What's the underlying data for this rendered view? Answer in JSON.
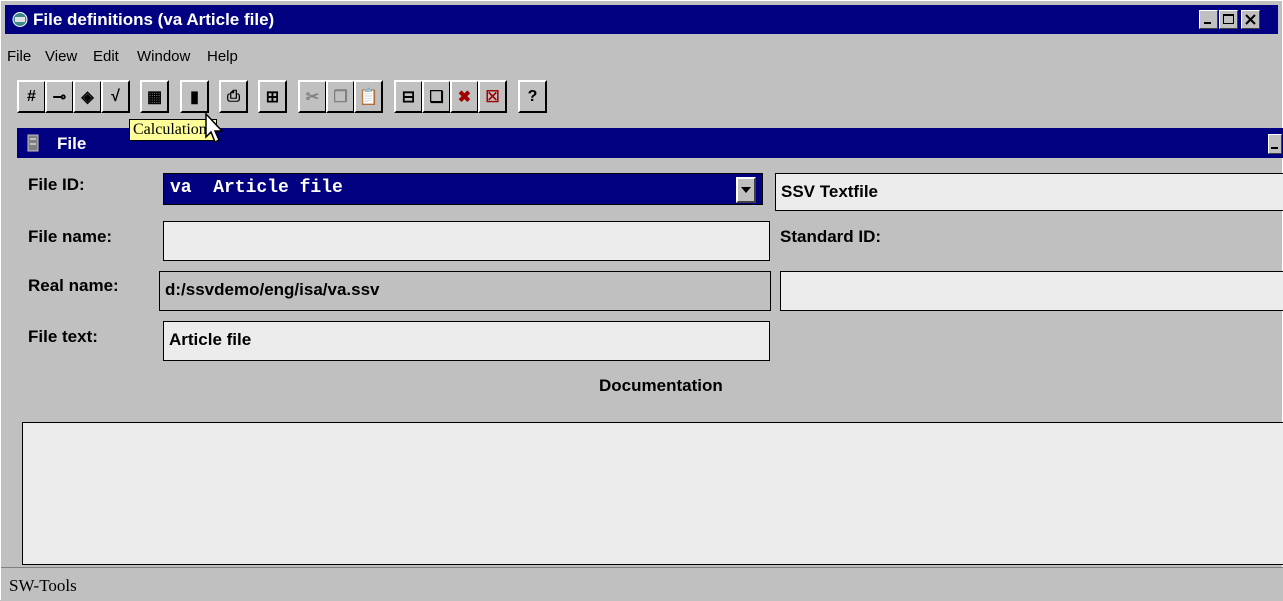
{
  "window": {
    "title": "File definitions (va Article file)"
  },
  "menu": [
    {
      "label": "File"
    },
    {
      "label": "View"
    },
    {
      "label": "Edit"
    },
    {
      "label": "Window"
    },
    {
      "label": "Help"
    }
  ],
  "toolbar": {
    "buttons": [
      {
        "icon": "hash-icon",
        "glyph": "#"
      },
      {
        "icon": "key-icon",
        "glyph": "⊸"
      },
      {
        "icon": "diamond-icon",
        "glyph": "◈"
      },
      {
        "icon": "check-icon",
        "glyph": "√"
      },
      {
        "icon": "calculator-icon",
        "glyph": "▦"
      },
      {
        "icon": "trash-icon",
        "glyph": "▮"
      },
      {
        "icon": "printer-icon",
        "glyph": "⎙"
      },
      {
        "icon": "tree-icon",
        "glyph": "⊞"
      },
      {
        "icon": "cut-icon",
        "glyph": "✂"
      },
      {
        "icon": "copy-icon",
        "glyph": "❐"
      },
      {
        "icon": "paste-icon",
        "glyph": "📋"
      },
      {
        "icon": "tile-icon",
        "glyph": "⊟"
      },
      {
        "icon": "cascade-icon",
        "glyph": "❏"
      },
      {
        "icon": "close-windows-icon",
        "glyph": "✖"
      },
      {
        "icon": "close-all-icon",
        "glyph": "☒"
      },
      {
        "icon": "help-icon",
        "glyph": "?"
      }
    ],
    "tooltip": "Calculations"
  },
  "child_window": {
    "title": "File"
  },
  "form": {
    "file_id_label": "File ID:",
    "file_id_value": "va  Article file",
    "file_id_type": "SSV Textfile",
    "file_name_label": "File name:",
    "file_name_value": "",
    "standard_id_label": "Standard ID:",
    "real_name_label": "Real name:",
    "real_name_value": "d:/ssvdemo/eng/isa/va.ssv",
    "standard_id_value": "",
    "file_text_label": "File text:",
    "file_text_value": "Article file",
    "documentation_label": "Documentation",
    "documentation_value": ""
  },
  "status": {
    "text": "SW-Tools"
  }
}
